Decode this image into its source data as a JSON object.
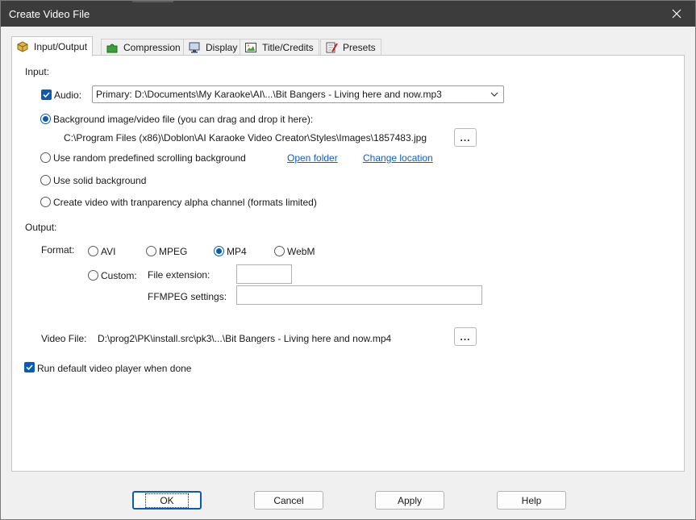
{
  "window": {
    "title": "Create Video File"
  },
  "tabs": [
    {
      "label": "Input/Output",
      "icon": "package-icon"
    },
    {
      "label": "Compression",
      "icon": "puzzle-icon"
    },
    {
      "label": "Display",
      "icon": "monitor-icon"
    },
    {
      "label": "Title/Credits",
      "icon": "picture-icon"
    },
    {
      "label": "Presets",
      "icon": "checklist-icon"
    }
  ],
  "input": {
    "heading": "Input:",
    "audio_label": "Audio:",
    "audio_checked": true,
    "audio_value": "Primary: D:\\Documents\\My Karaoke\\AI\\...\\Bit Bangers - Living here and now.mp3",
    "bg_image_label": "Background image/video file (you can drag and drop it here):",
    "bg_image_path": "C:\\Program Files (x86)\\Doblon\\AI Karaoke Video Creator\\Styles\\Images\\1857483.jpg",
    "browse_label": "...",
    "random_bg_label": "Use random predefined scrolling background",
    "open_folder_link": "Open folder",
    "change_location_link": "Change location",
    "solid_bg_label": "Use solid background",
    "alpha_label": "Create video with tranparency alpha channel (formats limited)",
    "selected_background": "image"
  },
  "output": {
    "heading": "Output:",
    "format_label": "Format:",
    "formats": [
      "AVI",
      "MPEG",
      "MP4",
      "WebM"
    ],
    "selected_format": "MP4",
    "custom_label": "Custom:",
    "file_extension_label": "File extension:",
    "file_extension_value": "",
    "ffmpeg_label": "FFMPEG settings:",
    "ffmpeg_value": "",
    "video_file_label": "Video File:",
    "video_file_path": "D:\\prog2\\PK\\install.src\\pk3\\...\\Bit Bangers - Living here and now.mp4",
    "browse_label": "..."
  },
  "run_player": {
    "label": "Run default video player when done",
    "checked": true
  },
  "buttons": {
    "ok": "OK",
    "cancel": "Cancel",
    "apply": "Apply",
    "help": "Help"
  },
  "colors": {
    "accent": "#0a5bb5",
    "link": "#0b5cd5",
    "titlebar": "#3c3c3c"
  }
}
